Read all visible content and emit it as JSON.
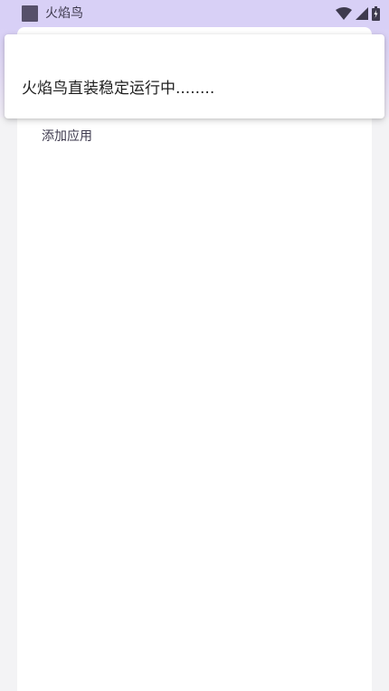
{
  "status_bar": {
    "title": "火焰鸟",
    "icons": [
      "app-icon",
      "wifi-icon",
      "signal-icon",
      "battery-icon"
    ]
  },
  "main": {
    "add_app_label": "添加应用"
  },
  "toast": {
    "message": "火焰鸟直装稳定运行中........"
  },
  "colors": {
    "status_bar_bg": "#d8d0f6",
    "card_bg": "#ffffff",
    "page_bg": "#f3f3f5",
    "text_primary": "#1f1f1f",
    "text_secondary": "#3e3a4e"
  }
}
